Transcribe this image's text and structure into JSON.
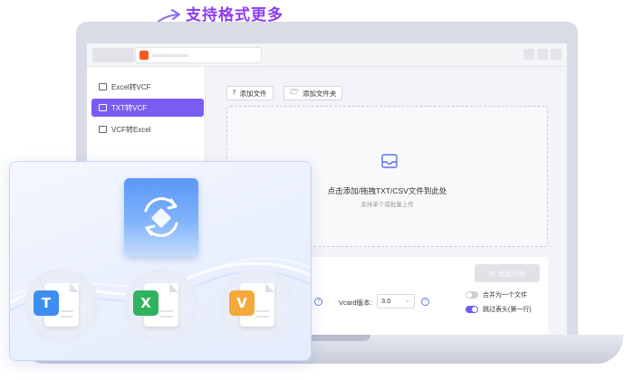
{
  "promo": {
    "caption": "支持格式更多"
  },
  "sidebar": {
    "items": [
      {
        "label": "Excel转VCF",
        "active": false
      },
      {
        "label": "TXT转VCF",
        "active": true
      },
      {
        "label": "VCF转Excel",
        "active": false
      }
    ]
  },
  "toolbar": {
    "add_file": "添加文件",
    "add_folder": "添加文件夹"
  },
  "dropzone": {
    "main_text": "点击添加/拖拽TXT/CSV文件到此处",
    "sub_text": "支持单个或批量上传"
  },
  "controls": {
    "start_all": "全部开始",
    "vcard_label": "Vcard版本:",
    "vcard_value": "3.0",
    "merge_label": "合并为一个文件",
    "merge_on": false,
    "skip_header_label": "跳过表头(第一行)",
    "skip_header_on": true
  },
  "file_types": [
    {
      "letter": "T",
      "color": "#3d8ef0"
    },
    {
      "letter": "X",
      "color": "#2fb35f"
    },
    {
      "letter": "V",
      "color": "#f5a93a"
    }
  ],
  "colors": {
    "accent": "#7a5cf3",
    "caption": "#8a3cf2"
  }
}
